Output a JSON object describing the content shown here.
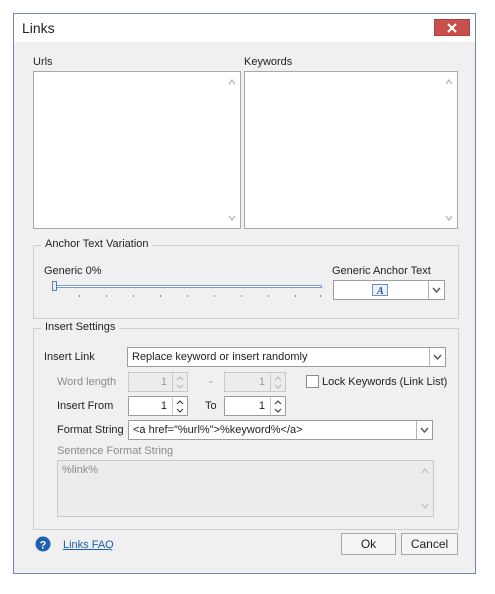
{
  "window": {
    "title": "Links"
  },
  "urls": {
    "label": "Urls"
  },
  "keywords": {
    "label": "Keywords"
  },
  "anchor": {
    "group_title": "Anchor Text Variation",
    "generic_label": "Generic 0%",
    "generic_value_percent": 0,
    "generic_anchor_label": "Generic Anchor Text"
  },
  "insert": {
    "group_title": "Insert Settings",
    "insert_link_label": "Insert Link",
    "insert_link_value": "Replace keyword or insert randomly",
    "word_length_label": "Word length",
    "word_length_from": "1",
    "word_length_sep": "-",
    "word_length_to": "1",
    "lock_keywords_label": "Lock Keywords (Link List)",
    "insert_from_label": "Insert From",
    "insert_from_value": "1",
    "to_label": "To",
    "to_value": "1",
    "format_string_label": "Format String",
    "format_string_value": "<a href=\"%url%\">%keyword%</a>",
    "sentence_format_label": "Sentence Format String",
    "sentence_format_value": "%link%"
  },
  "footer": {
    "faq_label": "Links FAQ",
    "ok_label": "Ok",
    "cancel_label": "Cancel"
  }
}
